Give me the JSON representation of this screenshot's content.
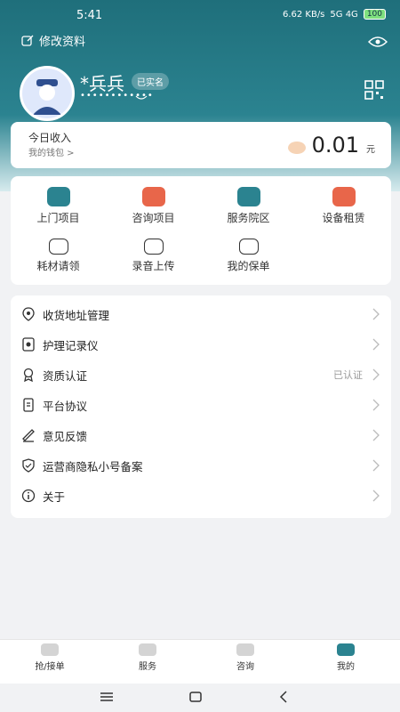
{
  "status": {
    "time": "5:41",
    "speed": "6.62 KB/s",
    "network": "5G 4G",
    "battery": "100"
  },
  "profile": {
    "edit_label": "修改资料",
    "name": "*兵兵",
    "verified_badge": "已实名",
    "masked_id": "••••••••••••"
  },
  "income": {
    "title": "今日收入",
    "wallet_label": "我的钱包 >",
    "amount": "0.01",
    "unit": "元"
  },
  "services": [
    {
      "label": "上门项目",
      "icon": "home-visit-icon",
      "color": "#2b8390"
    },
    {
      "label": "咨询项目",
      "icon": "consult-icon",
      "color": "#e8664a"
    },
    {
      "label": "服务院区",
      "icon": "location-icon",
      "color": "#2b8390"
    },
    {
      "label": "设备租赁",
      "icon": "equipment-icon",
      "color": "#e8664a"
    },
    {
      "label": "耗材请领",
      "icon": "syringe-icon",
      "color": "#333333"
    },
    {
      "label": "录音上传",
      "icon": "recording-icon",
      "color": "#333333"
    },
    {
      "label": "我的保单",
      "icon": "policy-icon",
      "color": "#333333"
    }
  ],
  "menu": [
    {
      "label": "收货地址管理",
      "icon": "address-icon",
      "value": ""
    },
    {
      "label": "护理记录仪",
      "icon": "recorder-icon",
      "value": ""
    },
    {
      "label": "资质认证",
      "icon": "certificate-icon",
      "value": "已认证"
    },
    {
      "label": "平台协议",
      "icon": "agreement-icon",
      "value": ""
    },
    {
      "label": "意见反馈",
      "icon": "feedback-icon",
      "value": ""
    },
    {
      "label": "运营商隐私小号备案",
      "icon": "privacy-shield-icon",
      "value": ""
    },
    {
      "label": "关于",
      "icon": "info-icon",
      "value": ""
    }
  ],
  "tabs": [
    {
      "label": "抢/接单",
      "active": false
    },
    {
      "label": "服务",
      "active": false
    },
    {
      "label": "咨询",
      "active": false
    },
    {
      "label": "我的",
      "active": true
    }
  ],
  "colors": {
    "brand": "#2b8390",
    "accent": "#e8664a"
  }
}
